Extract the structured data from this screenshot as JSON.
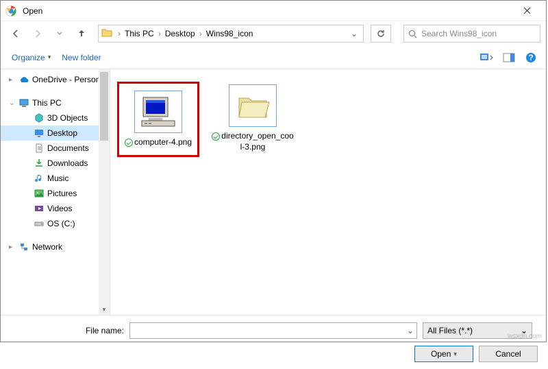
{
  "window": {
    "title": "Open"
  },
  "nav": {
    "breadcrumbs": [
      "This PC",
      "Desktop",
      "Wins98_icon"
    ],
    "search_placeholder": "Search Wins98_icon"
  },
  "toolbar": {
    "organize": "Organize",
    "new_folder": "New folder"
  },
  "sidebar": {
    "items": [
      {
        "label": "OneDrive - Person",
        "icon": "onedrive",
        "indent": false,
        "chev": "▸"
      },
      {
        "gap": true
      },
      {
        "label": "This PC",
        "icon": "pc",
        "indent": false,
        "chev": "⌄"
      },
      {
        "label": "3D Objects",
        "icon": "3d",
        "indent": true
      },
      {
        "label": "Desktop",
        "icon": "desktop",
        "indent": true,
        "selected": true
      },
      {
        "label": "Documents",
        "icon": "documents",
        "indent": true
      },
      {
        "label": "Downloads",
        "icon": "downloads",
        "indent": true
      },
      {
        "label": "Music",
        "icon": "music",
        "indent": true
      },
      {
        "label": "Pictures",
        "icon": "pictures",
        "indent": true
      },
      {
        "label": "Videos",
        "icon": "videos",
        "indent": true
      },
      {
        "label": "OS (C:)",
        "icon": "drive",
        "indent": true
      },
      {
        "gap": true
      },
      {
        "label": "Network",
        "icon": "network",
        "indent": false,
        "chev": "▸"
      }
    ]
  },
  "files": [
    {
      "name": "computer-4.png",
      "icon": "computer",
      "selected": true
    },
    {
      "name": "directory_open_cool-3.png",
      "icon": "folder-open",
      "selected": false
    }
  ],
  "footer": {
    "filename_label": "File name:",
    "filename_value": "",
    "filter": "All Files (*.*)",
    "open": "Open",
    "cancel": "Cancel"
  },
  "watermark": "wsxdn.com"
}
